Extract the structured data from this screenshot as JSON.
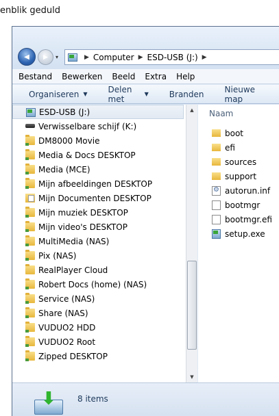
{
  "background": {
    "text": "enblik geduld"
  },
  "nav": {
    "back_glyph": "◀",
    "forward_glyph": "▶",
    "history_caret": "▾"
  },
  "address": {
    "segments": [
      "Computer",
      "ESD-USB (J:)"
    ],
    "separator": "▶"
  },
  "menubar": {
    "items": [
      "Bestand",
      "Bewerken",
      "Beeld",
      "Extra",
      "Help"
    ]
  },
  "toolbar": {
    "organize": "Organiseren",
    "share": "Delen met",
    "burn": "Branden",
    "new_folder": "Nieuwe map",
    "caret": "▼"
  },
  "nav_pane": {
    "items": [
      {
        "label": "ESD-USB (J:)",
        "icon": "usb-drive-icon",
        "selected": true
      },
      {
        "label": "Verwisselbare schijf (K:)",
        "icon": "removable-drive-icon"
      },
      {
        "label": "DM8000 Movie",
        "icon": "network-folder-icon"
      },
      {
        "label": "Media & Docs DESKTOP",
        "icon": "network-folder-icon"
      },
      {
        "label": "Media (MCE)",
        "icon": "network-folder-icon"
      },
      {
        "label": "Mijn afbeeldingen DESKTOP",
        "icon": "network-folder-icon"
      },
      {
        "label": "Mijn Documenten DESKTOP",
        "icon": "documents-folder-icon"
      },
      {
        "label": "Mijn muziek DESKTOP",
        "icon": "network-folder-icon"
      },
      {
        "label": "Mijn video's DESKTOP",
        "icon": "network-folder-icon"
      },
      {
        "label": "MultiMedia (NAS)",
        "icon": "network-folder-icon"
      },
      {
        "label": "Pix (NAS)",
        "icon": "network-folder-icon"
      },
      {
        "label": "RealPlayer Cloud",
        "icon": "folder-icon"
      },
      {
        "label": "Robert Docs (home) (NAS)",
        "icon": "network-folder-icon"
      },
      {
        "label": "Service (NAS)",
        "icon": "network-folder-icon"
      },
      {
        "label": "Share (NAS)",
        "icon": "network-folder-icon"
      },
      {
        "label": "VUDUO2 HDD",
        "icon": "network-folder-icon"
      },
      {
        "label": "VUDUO2 Root",
        "icon": "network-folder-icon"
      },
      {
        "label": "Zipped DESKTOP",
        "icon": "network-folder-icon"
      }
    ]
  },
  "scrollbar": {
    "up_glyph": "▲",
    "down_glyph": "▼"
  },
  "content": {
    "column_header": "Naam",
    "files": [
      {
        "name": "boot",
        "icon": "folder-icon"
      },
      {
        "name": "efi",
        "icon": "folder-icon"
      },
      {
        "name": "sources",
        "icon": "folder-icon"
      },
      {
        "name": "support",
        "icon": "folder-icon"
      },
      {
        "name": "autorun.inf",
        "icon": "settings-file-icon"
      },
      {
        "name": "bootmgr",
        "icon": "file-icon"
      },
      {
        "name": "bootmgr.efi",
        "icon": "file-icon"
      },
      {
        "name": "setup.exe",
        "icon": "setup-exe-icon"
      }
    ]
  },
  "status": {
    "item_count": "8 items"
  }
}
